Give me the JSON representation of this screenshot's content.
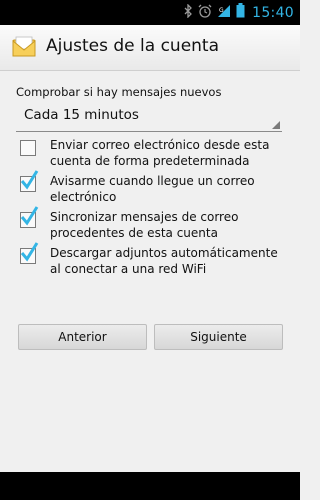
{
  "status_bar": {
    "time": "15:40",
    "icons": [
      "bluetooth-icon",
      "alarm-icon",
      "signal-icon",
      "battery-icon"
    ],
    "accent_color": "#33b5e5"
  },
  "title_bar": {
    "title": "Ajustes de la cuenta",
    "icon": "email-app-icon"
  },
  "sync": {
    "label": "Comprobar si hay mensajes nuevos",
    "selected_value": "Cada 15 minutos"
  },
  "options": [
    {
      "text": "Enviar correo electrónico desde esta cuenta de forma predeterminada",
      "checked": false
    },
    {
      "text": "Avisarme cuando llegue un correo electrónico",
      "checked": true
    },
    {
      "text": "Sincronizar mensajes de correo procedentes de esta cuenta",
      "checked": true
    },
    {
      "text": "Descargar adjuntos automáticamente al conectar a una red WiFi",
      "checked": true
    }
  ],
  "buttons": {
    "previous": "Anterior",
    "next": "Siguiente"
  },
  "colors": {
    "check": "#33b5e5",
    "background": "#f0f0f0"
  }
}
